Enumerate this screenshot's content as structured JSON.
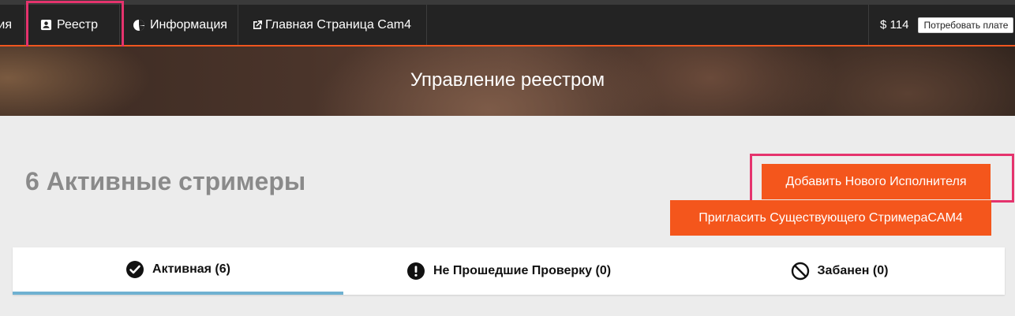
{
  "nav": {
    "items": [
      {
        "label": "ия",
        "icon": "none"
      },
      {
        "label": "Реестр",
        "icon": "contact-card-icon",
        "active": true
      },
      {
        "label": "Информация",
        "icon": "pie-chart-icon"
      },
      {
        "label": "Главная Страница Cam4",
        "icon": "external-link-icon"
      }
    ],
    "balance": "$ 114",
    "payout_label": "Потребовать плате"
  },
  "hero": {
    "title": "Управление реестром"
  },
  "main": {
    "heading": "6 Активные стримеры",
    "add_button": "Добавить Нового Исполнителя",
    "invite_button": "Пригласить Существующего СтримераCAM4"
  },
  "tabs": [
    {
      "label": "Активная (6)",
      "icon": "check-circle-icon",
      "active": true
    },
    {
      "label": "Не Прошедшие Проверку (0)",
      "icon": "exclamation-circle-icon"
    },
    {
      "label": "Забанен (0)",
      "icon": "ban-icon"
    }
  ],
  "colors": {
    "accent": "#f4561c",
    "highlight": "#e5336d",
    "tab_underline": "#6fb1d1",
    "topbar": "#232323"
  }
}
